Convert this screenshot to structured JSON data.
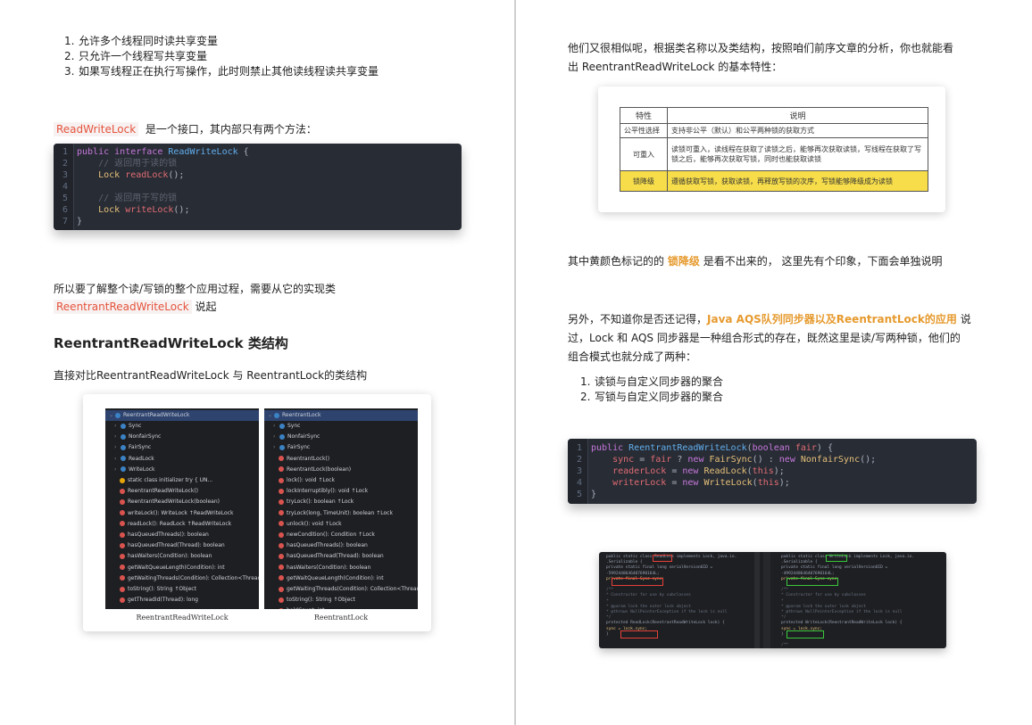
{
  "left": {
    "list1": [
      {
        "num": "1.",
        "text": "允许多个线程同时读共享变量"
      },
      {
        "num": "2.",
        "text": "只允许一个线程写共享变量"
      },
      {
        "num": "3.",
        "text": "如果写线程正在执行写操作，此时则禁止其他读线程读共享变量"
      }
    ],
    "interface_para": {
      "code": "ReadWriteLock",
      "text": "是一个接口，其内部只有两个方法："
    },
    "code1": [
      {
        "n": "1",
        "t": "public interface ReadWriteLock {"
      },
      {
        "n": "2",
        "t": "    // 返回用于读的锁"
      },
      {
        "n": "3",
        "t": "    Lock readLock();"
      },
      {
        "n": "4",
        "t": ""
      },
      {
        "n": "5",
        "t": "    // 返回用于写的锁"
      },
      {
        "n": "6",
        "t": "    Lock writeLock();"
      },
      {
        "n": "7",
        "t": "}"
      }
    ],
    "impl_para": {
      "text_before": "所以要了解整个读/写锁的整个应用过程，需要从它的实现类",
      "code": "ReentrantReadWriteLock",
      "text_after": "说起"
    },
    "heading": "ReentrantReadWriteLock 类结构",
    "compare_para": "直接对比ReentrantReadWriteLock 与 ReentrantLock的类结构",
    "tree_left": {
      "root": "ReentrantReadWriteLock",
      "items": [
        "Sync",
        "NonfairSync",
        "FairSync",
        "ReadLock",
        "WriteLock",
        "static class initializer try {          UN...",
        "ReentrantReadWriteLock()",
        "ReentrantReadWriteLock(boolean)",
        "writeLock(): WriteLock ↑ReadWriteLock",
        "readLock(): ReadLock ↑ReadWriteLock",
        "hasQueuedThreads(): boolean",
        "hasQueuedThread(Thread): boolean",
        "hasWaiters(Condition): boolean",
        "getWaitQueueLength(Condition): int",
        "getWaitingThreads(Condition): Collection<Thread>",
        "toString(): String ↑Object",
        "getThreadId(Thread): long"
      ],
      "caption": "ReentrantReadWriteLock"
    },
    "tree_right": {
      "root": "ReentrantLock",
      "items": [
        "Sync",
        "NonfairSync",
        "FairSync",
        "ReentrantLock()",
        "ReentrantLock(boolean)",
        "lock(): void ↑Lock",
        "lockInterruptibly(): void ↑Lock",
        "tryLock(): boolean ↑Lock",
        "tryLock(long, TimeUnit): boolean ↑Lock",
        "unlock(): void ↑Lock",
        "newCondition(): Condition ↑Lock",
        "hasQueuedThreads(): boolean",
        "hasQueuedThread(Thread): boolean",
        "hasWaiters(Condition): boolean",
        "getWaitQueueLength(Condition): int",
        "getWaitingThreads(Condition): Collection<Thread>",
        "toString(): String ↑Object",
        "holdCount: int"
      ],
      "caption": "ReentrantLock"
    }
  },
  "right": {
    "intro_para": {
      "line1": "他们又很相似呢，根据类名称以及类结构，按照咱们前序文章的分析，你也就能看",
      "line2": "出 ReentrantReadWriteLock 的基本特性："
    },
    "table": {
      "headers": [
        "特性",
        "说明"
      ],
      "rows": [
        {
          "feature": "公平性选择",
          "desc": "支持非公平（默认）和公平两种锁的获取方式"
        },
        {
          "feature": "可重入",
          "desc": "读锁可重入，读线程在获取了读锁之后，能够再次获取读锁，写线程在获取了写锁之后，能够再次获取写锁，同时也能获取读锁"
        },
        {
          "feature": "锁降级",
          "desc": "遵循获取写锁，获取读锁，再释放写锁的次序，写锁能够降级成为读锁"
        }
      ]
    },
    "yellow_para": {
      "before": "其中黄颜色标记的的",
      "highlight": "锁降级",
      "after": "是看不出来的， 这里先有个印象，下面会单独说明"
    },
    "aqs_para": {
      "before": "另外，不知道你是否还记得，",
      "link": "Java AQS队列同步器以及ReentrantLock的应用",
      "after1": "说",
      "line2": "过，Lock 和 AQS 同步器是一种组合形式的存在，既然这里是读/写两种锁，他们的",
      "line3": "组合模式也就分成了两种："
    },
    "list2": [
      {
        "num": "1.",
        "text": "读锁与自定义同步器的聚合"
      },
      {
        "num": "2.",
        "text": "写锁与自定义同步器的聚合"
      }
    ],
    "code2": [
      {
        "n": "1",
        "t": "public ReentrantReadWriteLock(boolean fair) {"
      },
      {
        "n": "2",
        "t": "    sync = fair ? new FairSync() : new NonfairSync();"
      },
      {
        "n": "3",
        "t": "    readerLock = new ReadLock(this);"
      },
      {
        "n": "4",
        "t": "    writerLock = new WriteLock(this);"
      },
      {
        "n": "5",
        "t": "}"
      }
    ],
    "screenshot": {
      "left_lines": [
        "public static class ReadLock implements Lock, java.io.",
        ".Serializable {",
        "    private static final long serialVersionUID =",
        "-5992448646407690164L;",
        "    private final Sync sync;",
        "",
        "    /**",
        "     * Constructor for use by subclasses",
        "     *",
        "     * @param lock the outer lock object",
        "     * @throws NullPointerException if the lock is null",
        "     */",
        "    protected ReadLock(ReentrantReadWriteLock lock) {",
        "        sync = lock.sync;",
        "    }"
      ],
      "right_lines": [
        "public static class WriteLock implements Lock, java.io.",
        ".Serializable {",
        "    private static final long serialVersionUID =",
        "-4992448646407690164L;",
        "    private final Sync sync;",
        "",
        "    /**",
        "     * Constructor for use by subclasses",
        "     *",
        "     * @param lock the outer lock object",
        "     * @throws NullPointerException if the lock is null",
        "     */",
        "    protected WriteLock(ReentrantReadWriteLock lock) {",
        "        sync = lock.sync;",
        "    }",
        "",
        "    /**"
      ]
    }
  }
}
